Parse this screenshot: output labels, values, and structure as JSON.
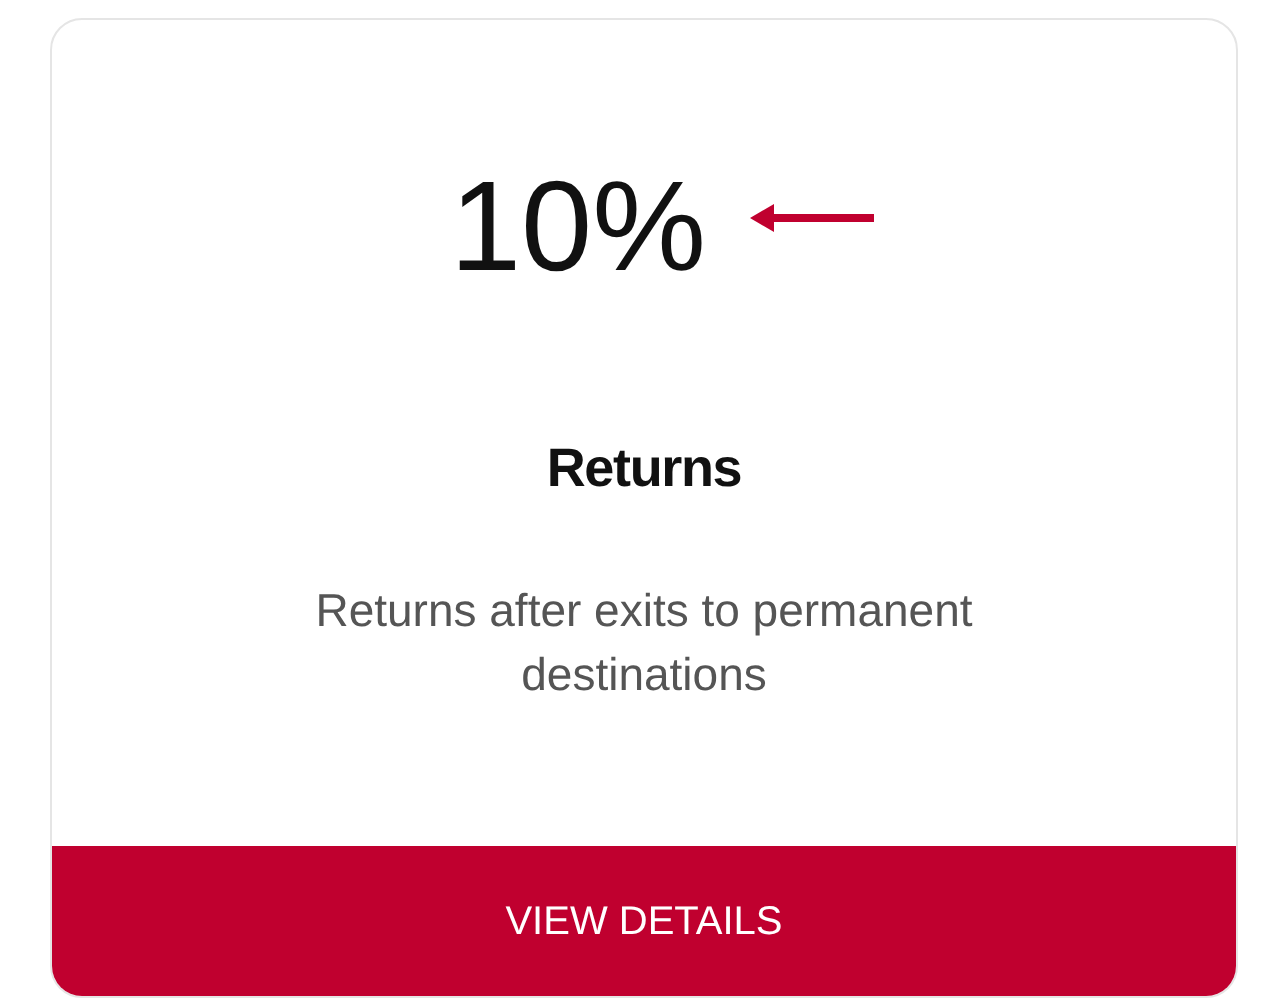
{
  "card": {
    "value": "10%",
    "title": "Returns",
    "description": "Returns after exits to permanent destinations",
    "button": "VIEW DETAILS"
  }
}
